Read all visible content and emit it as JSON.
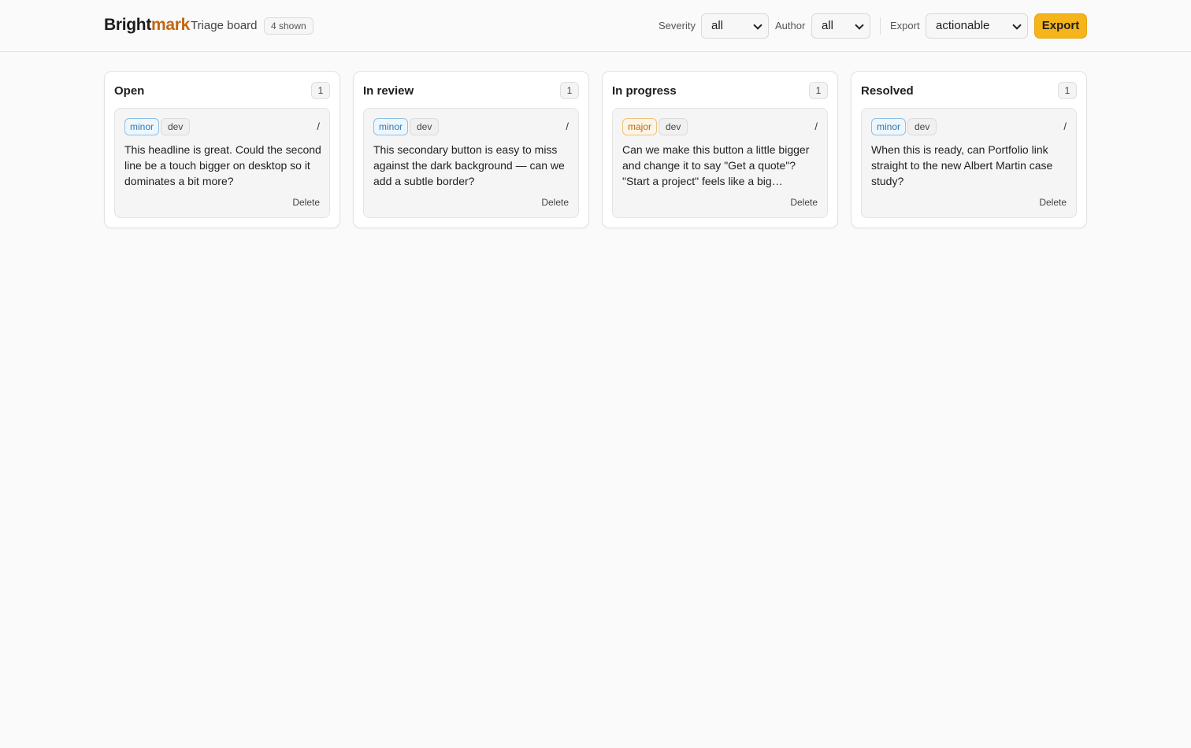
{
  "header": {
    "brand_part1": "Bright",
    "brand_part2": "mark",
    "board_title": "Triage board",
    "shown_badge": "4 shown",
    "severity_label": "Severity",
    "severity_value": "all",
    "author_label": "Author",
    "author_value": "all",
    "export_label": "Export",
    "export_value": "actionable",
    "export_button": "Export"
  },
  "columns": [
    {
      "title": "Open",
      "count": "1",
      "card": {
        "severity": "minor",
        "author": "dev",
        "edit": "/",
        "text": "This headline is great. Could the second line be a touch bigger on desktop so it dominates a bit more?",
        "delete": "Delete"
      }
    },
    {
      "title": "In review",
      "count": "1",
      "card": {
        "severity": "minor",
        "author": "dev",
        "edit": "/",
        "text": "This secondary button is easy to miss against the dark background — can we add a subtle border?",
        "delete": "Delete"
      }
    },
    {
      "title": "In progress",
      "count": "1",
      "card": {
        "severity": "major",
        "author": "dev",
        "edit": "/",
        "text": "Can we make this button a little bigger and change it to say \"Get a quote\"? \"Start a project\" feels like a big…",
        "delete": "Delete"
      }
    },
    {
      "title": "Resolved",
      "count": "1",
      "card": {
        "severity": "minor",
        "author": "dev",
        "edit": "/",
        "text": "When this is ready, can Portfolio link straight to the new Albert Martin case study?",
        "delete": "Delete"
      }
    }
  ],
  "colors": {
    "accent": "#f5b41a",
    "brand_mark": "#c2650f",
    "minor": "#2a7ab8",
    "major": "#c26a0a"
  }
}
